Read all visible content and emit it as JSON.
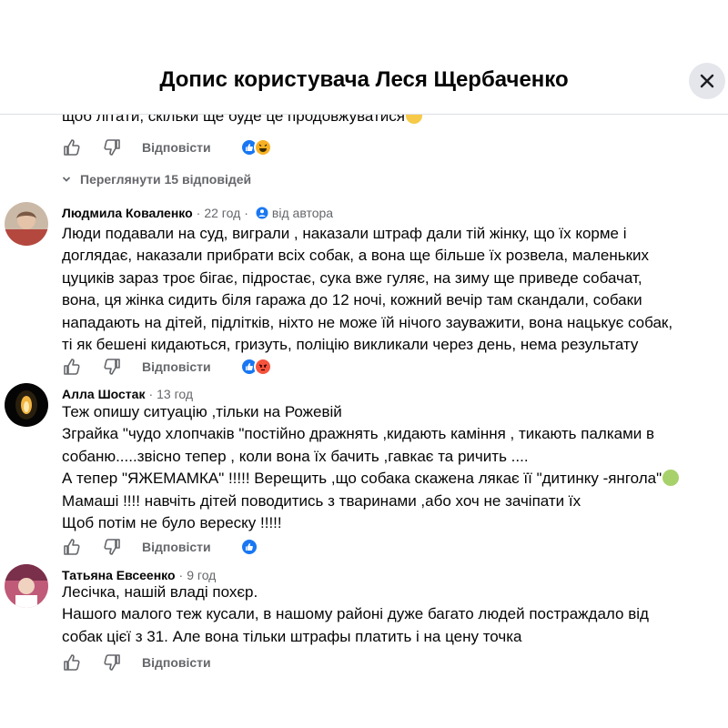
{
  "header": {
    "title": "Допис користувача Леся Щербаченко",
    "close_icon": "close-icon"
  },
  "partial_comment": {
    "text_line": "щоб літати, скільки ще буде це продовжуватися",
    "reply_label": "Відповісти",
    "reactions": [
      "like",
      "haha"
    ]
  },
  "view_replies": {
    "label": "Переглянути 15 відповідей"
  },
  "comments": [
    {
      "author": "Людмила Коваленко",
      "time": "22 год",
      "badge": "від автора",
      "lines": [
        "Люди подавали на суд, виграли , наказали штраф дали тій жінку, що їх корме і",
        "доглядає, наказали прибрати всіх собак, а вона ще більше їх розвела, маленьких",
        "цуциків зараз троє бігає, підростає, сука вже гуляє, на зиму ще приведе собачат,",
        "вона, ця жінка сидить біля гаража до 12 ночі, кожний вечір там скандали, собаки",
        "нападають на дітей, підлітків, ніхто не може їй нічого зауважити, вона нацькує собак,",
        "ті як бешені кидаються, гризуть, поліцію викликали через день, нема результату"
      ],
      "reply_label": "Відповісти",
      "reactions": [
        "like",
        "angry"
      ]
    },
    {
      "author": "Алла Шостак",
      "time": "13 год",
      "lines": [
        "Теж опишу ситуацію ,тільки на Рожевій",
        "Зграйка \"чудо хлопчаків \"постійно дражнять ,кидають каміння , тикають палками в",
        "собаню.....звісно тепер , коли вона їх бачить ,гавкає та ричить ....",
        "А тепер \"ЯЖЕМАМКА\" !!!!! Верещить ,що собака скажена лякає її \"дитинку -янгола\"",
        "Мамаші !!!! навчіть дітей поводитись з тваринами ,або хоч не зачіпати їх",
        "Щоб потім не було вереску !!!!!"
      ],
      "reply_label": "Відповісти",
      "reactions": [
        "like"
      ]
    },
    {
      "author": "Татьяна Евсеенко",
      "time": "9 год",
      "lines": [
        "Лесічка, нашій владі похєр.",
        "Нашого малого теж кусали, в нашому районі дуже багато людей постраждало від",
        "собак цієї з 31. Але вона тільки штрафы платить і на цену точка"
      ],
      "reply_label": "Відповісти",
      "reactions": []
    }
  ],
  "colors": {
    "text": "#050505",
    "secondary": "#65676b",
    "like_blue": "#1877f2",
    "angry_orange": "#f5533d",
    "haha_yellow": "#f7b125"
  }
}
